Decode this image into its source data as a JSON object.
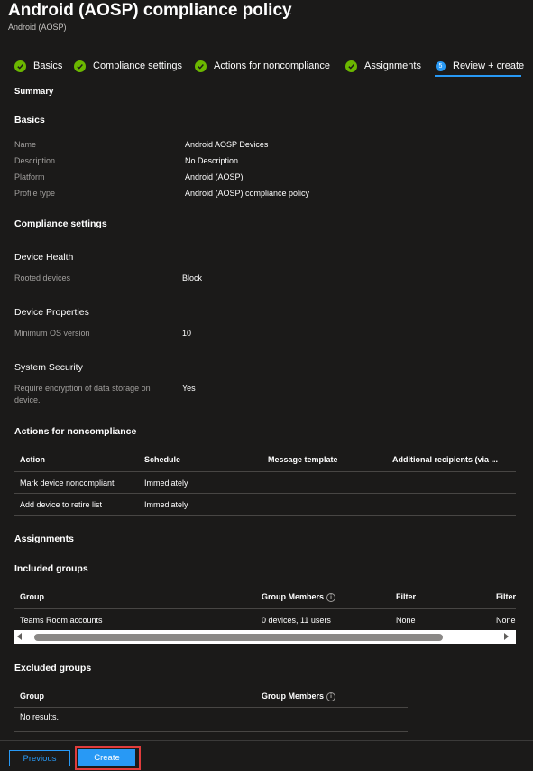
{
  "header": {
    "title": "Android (AOSP) compliance policy",
    "more": "...",
    "subtitle": "Android (AOSP)"
  },
  "wizard": {
    "tabs": [
      {
        "label": "Basics",
        "state": "complete"
      },
      {
        "label": "Compliance settings",
        "state": "complete"
      },
      {
        "label": "Actions for noncompliance",
        "state": "complete"
      },
      {
        "label": "Assignments",
        "state": "complete"
      },
      {
        "label": "Review + create",
        "state": "current",
        "step": "5"
      }
    ]
  },
  "summary": {
    "heading": "Summary",
    "basics": {
      "heading": "Basics",
      "rows": [
        {
          "label": "Name",
          "value": "Android AOSP Devices"
        },
        {
          "label": "Description",
          "value": "No Description"
        },
        {
          "label": "Platform",
          "value": "Android (AOSP)"
        },
        {
          "label": "Profile type",
          "value": "Android (AOSP) compliance policy"
        }
      ]
    },
    "compliance": {
      "heading": "Compliance settings",
      "device_health": {
        "heading": "Device Health",
        "label": "Rooted devices",
        "value": "Block"
      },
      "device_properties": {
        "heading": "Device Properties",
        "label": "Minimum OS version",
        "value": "10"
      },
      "system_security": {
        "heading": "System Security",
        "label_line1": "Require encryption of data storage on",
        "label_line2": "device.",
        "value": "Yes"
      }
    },
    "actions": {
      "heading": "Actions for noncompliance",
      "columns": [
        "Action",
        "Schedule",
        "Message template",
        "Additional recipients (via ..."
      ],
      "rows": [
        {
          "action": "Mark device noncompliant",
          "schedule": "Immediately"
        },
        {
          "action": "Add device to retire list",
          "schedule": "Immediately"
        }
      ]
    },
    "assignments": {
      "heading": "Assignments",
      "included": {
        "heading": "Included groups",
        "columns": [
          "Group",
          "Group Members",
          "Filter",
          "Filter"
        ],
        "rows": [
          {
            "group": "Teams Room accounts",
            "members": "0 devices, 11 users",
            "filter": "None",
            "filter2": "None"
          }
        ]
      },
      "excluded": {
        "heading": "Excluded groups",
        "columns": [
          "Group",
          "Group Members"
        ],
        "empty": "No results."
      }
    }
  },
  "footer": {
    "previous_label": "Previous",
    "create_label": "Create",
    "highlight_color": "#e03c3c",
    "accent_color": "#2899f5"
  },
  "icons": {
    "info": "i"
  }
}
